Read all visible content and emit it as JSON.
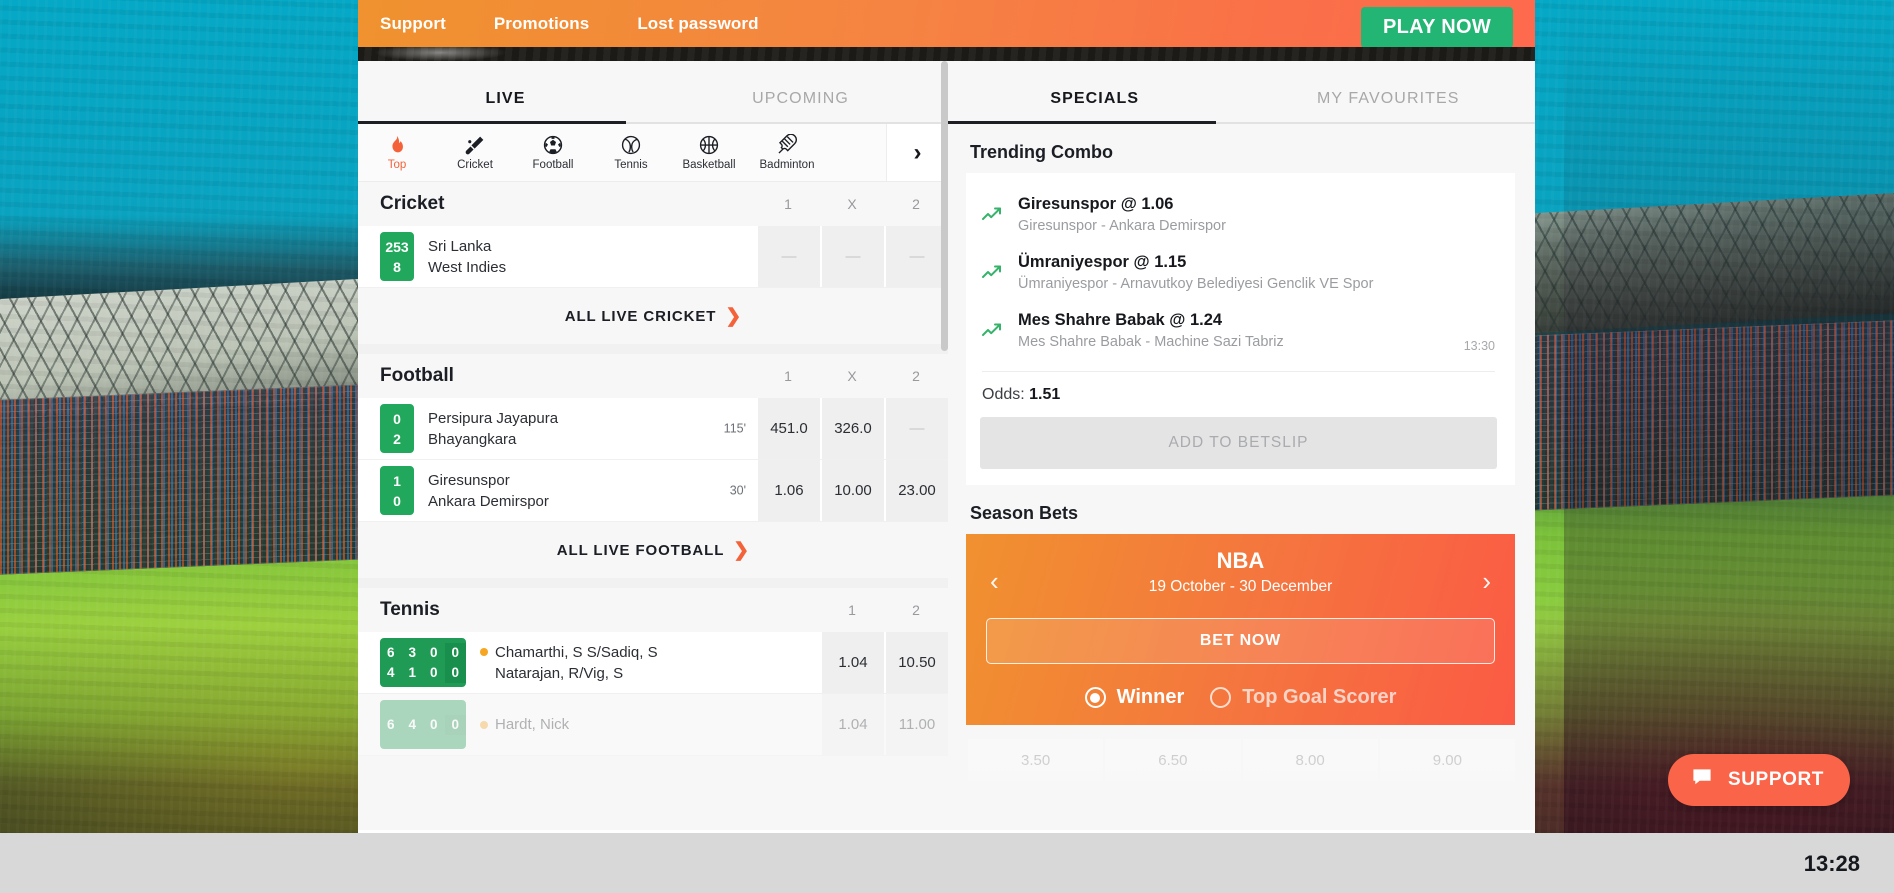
{
  "topnav": {
    "links": [
      {
        "label": "Support",
        "name": "nav-support"
      },
      {
        "label": "Promotions",
        "name": "nav-promotions"
      },
      {
        "label": "Lost password",
        "name": "nav-lost-password"
      }
    ],
    "play_now": "PLAY NOW",
    "play_now_color": "#22b573",
    "accent_color": "#f4623a"
  },
  "left": {
    "tabs": [
      {
        "label": "LIVE",
        "active": true
      },
      {
        "label": "UPCOMING",
        "active": false
      }
    ],
    "sports": [
      {
        "label": "Top",
        "icon": "fire-icon",
        "active": true
      },
      {
        "label": "Cricket",
        "icon": "cricket-bat-icon",
        "active": false
      },
      {
        "label": "Football",
        "icon": "football-icon",
        "active": false
      },
      {
        "label": "Tennis",
        "icon": "tennis-ball-icon",
        "active": false
      },
      {
        "label": "Basketball",
        "icon": "basketball-icon",
        "active": false
      },
      {
        "label": "Badminton",
        "icon": "shuttlecock-icon",
        "active": false
      }
    ],
    "next_arrow": "›",
    "sections": [
      {
        "title": "Cricket",
        "columns": [
          "1",
          "X",
          "2"
        ],
        "matches": [
          {
            "scores": [
              "253",
              "8"
            ],
            "teams": [
              "Sri Lanka",
              "West Indies"
            ],
            "minute": "",
            "odds": [
              "—",
              "—",
              "—"
            ]
          }
        ],
        "all_link": "ALL LIVE CRICKET"
      },
      {
        "title": "Football",
        "columns": [
          "1",
          "X",
          "2"
        ],
        "matches": [
          {
            "scores": [
              "0",
              "2"
            ],
            "teams": [
              "Persipura Jayapura",
              "Bhayangkara"
            ],
            "minute": "115'",
            "odds": [
              "451.0",
              "326.0",
              "—"
            ]
          },
          {
            "scores": [
              "1",
              "0"
            ],
            "teams": [
              "Giresunspor",
              "Ankara Demirspor"
            ],
            "minute": "30'",
            "odds": [
              "1.06",
              "10.00",
              "23.00"
            ]
          }
        ],
        "all_link": "ALL LIVE FOOTBALL"
      },
      {
        "title": "Tennis",
        "columns": [
          "1",
          "2"
        ],
        "matches": [
          {
            "sets_top": [
              "6",
              "3",
              "0",
              "0"
            ],
            "sets_bottom": [
              "4",
              "1",
              "0",
              "0"
            ],
            "teams": [
              "Chamarthi, S S/Sadiq, S",
              "Natarajan, R/Vig, S"
            ],
            "odds": [
              "1.04",
              "10.50"
            ]
          },
          {
            "sets_top": [
              "6",
              "4",
              "0",
              "0"
            ],
            "sets_bottom": [
              "",
              "",
              "",
              ""
            ],
            "teams": [
              "Hardt, Nick",
              ""
            ],
            "odds": [
              "1.04",
              "11.00"
            ]
          }
        ],
        "all_link": ""
      }
    ]
  },
  "right": {
    "tabs": [
      {
        "label": "SPECIALS",
        "active": true
      },
      {
        "label": "MY FAVOURITES",
        "active": false
      }
    ],
    "trending": {
      "heading": "Trending Combo",
      "items": [
        {
          "title": "Giresunspor @ 1.06",
          "subtitle": "Giresunspor - Ankara Demirspor",
          "time": "",
          "icon": "trend-up-icon"
        },
        {
          "title": "Ümraniyespor @ 1.15",
          "subtitle": "Ümraniyespor - Arnavutkoy Belediyesi Genclik VE Spor",
          "time": "",
          "icon": "trend-up-icon"
        },
        {
          "title": "Mes Shahre Babak @ 1.24",
          "subtitle": "Mes Shahre Babak - Machine Sazi Tabriz",
          "time": "13:30",
          "icon": "trend-up-icon"
        }
      ],
      "odds_label": "Odds:",
      "odds_value": "1.51",
      "add_button": "ADD TO BETSLIP"
    },
    "season": {
      "heading": "Season Bets",
      "title": "NBA",
      "dates": "19 October - 30 December",
      "prev_arrow": "‹",
      "next_arrow": "›",
      "bet_now": "BET NOW",
      "radios": [
        {
          "label": "Winner",
          "selected": true
        },
        {
          "label": "Top Goal Scorer",
          "selected": false
        }
      ],
      "odds": [
        "3.50",
        "6.50",
        "8.00",
        "9.00"
      ]
    }
  },
  "support_button": {
    "label": "SUPPORT",
    "icon": "chat-bubble-icon",
    "color": "#fa6449"
  },
  "taskbar": {
    "clock": "13:28"
  }
}
